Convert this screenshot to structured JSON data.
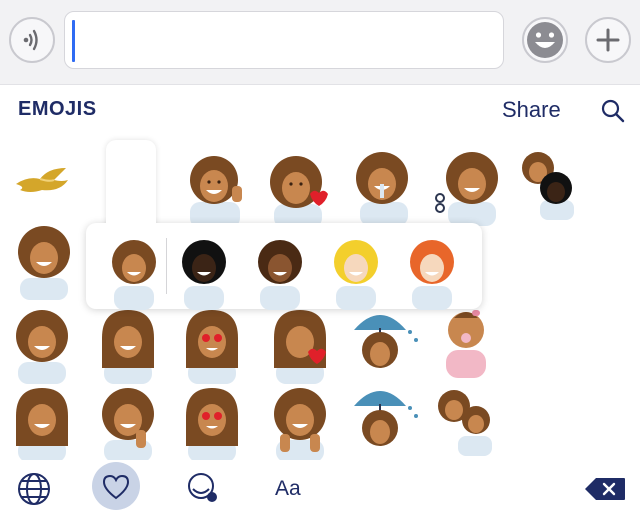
{
  "header": {
    "title": "EMOJIS",
    "share_label": "Share"
  },
  "message_input": {
    "value": "",
    "placeholder": ""
  },
  "icons": {
    "voice": "audio-wave-icon",
    "smiley": "smiley-face-icon",
    "add": "plus-icon",
    "search": "search-icon",
    "globe": "globe-icon",
    "favorites": "heart-icon",
    "sticker": "sticker-icon",
    "backspace": "backspace-icon"
  },
  "toolbar": {
    "text_mode_label": "Aa"
  },
  "colors": {
    "brand_navy": "#1f2c66",
    "caret_blue": "#2f6bf3",
    "selected_tab_bg": "#c9d3e6",
    "hair_brown": "#7a4a22",
    "skin_medium": "#c8874f",
    "shirt_light": "#dce8f2"
  },
  "skin_tone_popup": {
    "options": [
      "default",
      "dark",
      "medium-dark",
      "blonde-light",
      "red-light"
    ]
  }
}
